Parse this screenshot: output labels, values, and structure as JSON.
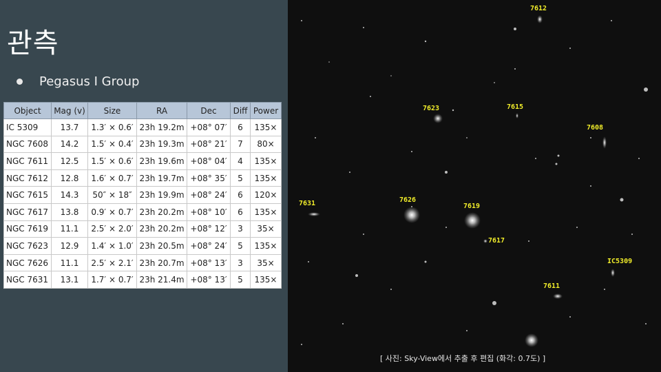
{
  "slide": {
    "title": "관측",
    "bullet": "Pegasus I Group",
    "caption": "[ 사진: Sky-View에서 추출 후 편집 (화각: 0.7도) ]"
  },
  "table": {
    "headers": [
      "Object",
      "Mag (v)",
      "Size",
      "RA",
      "Dec",
      "Diff",
      "Power"
    ],
    "rows": [
      [
        "IC 5309",
        "13.7",
        "1.3′ × 0.6′",
        "23h 19.2m",
        "+08° 07′",
        "6",
        "135×"
      ],
      [
        "NGC 7608",
        "14.2",
        "1.5′ × 0.4′",
        "23h 19.3m",
        "+08° 21′",
        "7",
        "80×"
      ],
      [
        "NGC 7611",
        "12.5",
        "1.5′ × 0.6′",
        "23h 19.6m",
        "+08° 04′",
        "4",
        "135×"
      ],
      [
        "NGC 7612",
        "12.8",
        "1.6′ × 0.7′",
        "23h 19.7m",
        "+08° 35′",
        "5",
        "135×"
      ],
      [
        "NGC 7615",
        "14.3",
        "50″ × 18″",
        "23h 19.9m",
        "+08° 24′",
        "6",
        "120×"
      ],
      [
        "NGC 7617",
        "13.8",
        "0.9′ × 0.7′",
        "23h 20.2m",
        "+08° 10′",
        "6",
        "135×"
      ],
      [
        "NGC 7619",
        "11.1",
        "2.5′ × 2.0′",
        "23h 20.2m",
        "+08° 12′",
        "3",
        "35×"
      ],
      [
        "NGC 7623",
        "12.9",
        "1.4′ × 1.0′",
        "23h 20.5m",
        "+08° 24′",
        "5",
        "135×"
      ],
      [
        "NGC 7626",
        "11.1",
        "2.5′ × 2.1′",
        "23h 20.7m",
        "+08° 13′",
        "3",
        "35×"
      ],
      [
        "NGC 7631",
        "13.1",
        "1.7′ × 0.7′",
        "23h 21.4m",
        "+08° 13′",
        "5",
        "135×"
      ]
    ]
  },
  "photo_labels": {
    "l7612": "7612",
    "l7623": "7623",
    "l7615": "7615",
    "l7608": "7608",
    "l7631": "7631",
    "l7626": "7626",
    "l7619": "7619",
    "l7617": "7617",
    "l5309": "IC5309",
    "l7611": "7611"
  },
  "colors": {
    "panel": "#38474f",
    "table_header": "#b7c6d8",
    "label_yellow": "#f2ee2a"
  }
}
